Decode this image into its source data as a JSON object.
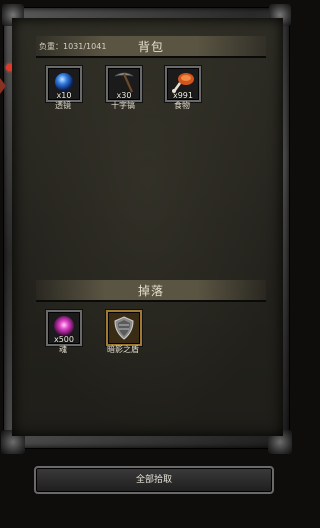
{
  "bag": {
    "title": "背包",
    "weight": "负重：1031/1041",
    "items": [
      {
        "name": "透镜",
        "qty": "x10"
      },
      {
        "name": "十字镐",
        "qty": "x30"
      },
      {
        "name": "食物",
        "qty": "x991"
      }
    ]
  },
  "drop": {
    "title": "掉落",
    "items": [
      {
        "name": "魂",
        "qty": "x500"
      },
      {
        "name": "暗影之盾",
        "qty": ""
      }
    ]
  },
  "actions": {
    "pickup_all_label": "全部拾取"
  },
  "colors": {
    "header": "#5a5442",
    "panel": "#2a2921",
    "notification": "#e23a2a",
    "gold_border": "#a07a30"
  }
}
